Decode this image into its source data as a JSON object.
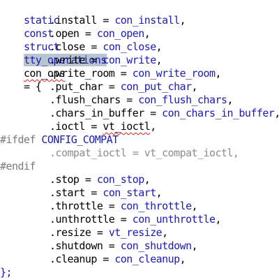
{
  "editor": {
    "lines": [
      {
        "kind": "decl",
        "tokens": [
          "static",
          "const",
          "struct",
          "tty_operations",
          "con_ops",
          "= {"
        ]
      },
      {
        "kind": "field",
        "field": ".install",
        "eq": " = ",
        "value": "con_install",
        "end": ","
      },
      {
        "kind": "field",
        "field": ".open",
        "eq": " = ",
        "value": "con_open",
        "end": ","
      },
      {
        "kind": "field",
        "field": ".close",
        "eq": " = ",
        "value": "con_close",
        "end": ","
      },
      {
        "kind": "field",
        "field": ".write",
        "eq": " = ",
        "value": "con_write",
        "end": ","
      },
      {
        "kind": "field",
        "field": ".write_room",
        "eq": " = ",
        "value": "con_write_room",
        "end": ","
      },
      {
        "kind": "field",
        "field": ".put_char",
        "eq": " = ",
        "value": "con_put_char",
        "end": ","
      },
      {
        "kind": "field",
        "field": ".flush_chars",
        "eq": " = ",
        "value": "con_flush_chars",
        "end": ","
      },
      {
        "kind": "field",
        "field": ".chars_in_buffer",
        "eq": " = ",
        "value": "con_chars_in_buffer",
        "end": ","
      },
      {
        "kind": "field",
        "field": ".ioctl",
        "eq": " = ",
        "value": "vt_ioctl",
        "end": ","
      },
      {
        "kind": "ifdef",
        "directive": "#ifdef",
        "macro": "CONFIG_COMPAT"
      },
      {
        "kind": "inactive",
        "text": ".compat_ioctl = vt_compat_ioctl,"
      },
      {
        "kind": "endif",
        "directive": "#endif"
      },
      {
        "kind": "field",
        "field": ".stop",
        "eq": " = ",
        "value": "con_stop",
        "end": ","
      },
      {
        "kind": "field",
        "field": ".start",
        "eq": " = ",
        "value": "con_start",
        "end": ","
      },
      {
        "kind": "field",
        "field": ".throttle",
        "eq": " = ",
        "value": "con_throttle",
        "end": ","
      },
      {
        "kind": "field",
        "field": ".unthrottle",
        "eq": " = ",
        "value": "con_unthrottle",
        "end": ","
      },
      {
        "kind": "field",
        "field": ".resize",
        "eq": " = ",
        "value": "vt_resize",
        "end": ","
      },
      {
        "kind": "field",
        "field": ".shutdown",
        "eq": " = ",
        "value": "con_shutdown",
        "end": ","
      },
      {
        "kind": "field",
        "field": ".cleanup",
        "eq": " = ",
        "value": "con_cleanup",
        "end": ","
      },
      {
        "kind": "close",
        "text": "};"
      }
    ]
  },
  "colors": {
    "keyword": "#1a1ab5",
    "identifier": "#000000",
    "preprocessor": "#7a7a7a",
    "inactive_code": "#8c8c8c",
    "highlight_background": "#b8c5ce",
    "spelling_squiggle": "#e02020"
  }
}
